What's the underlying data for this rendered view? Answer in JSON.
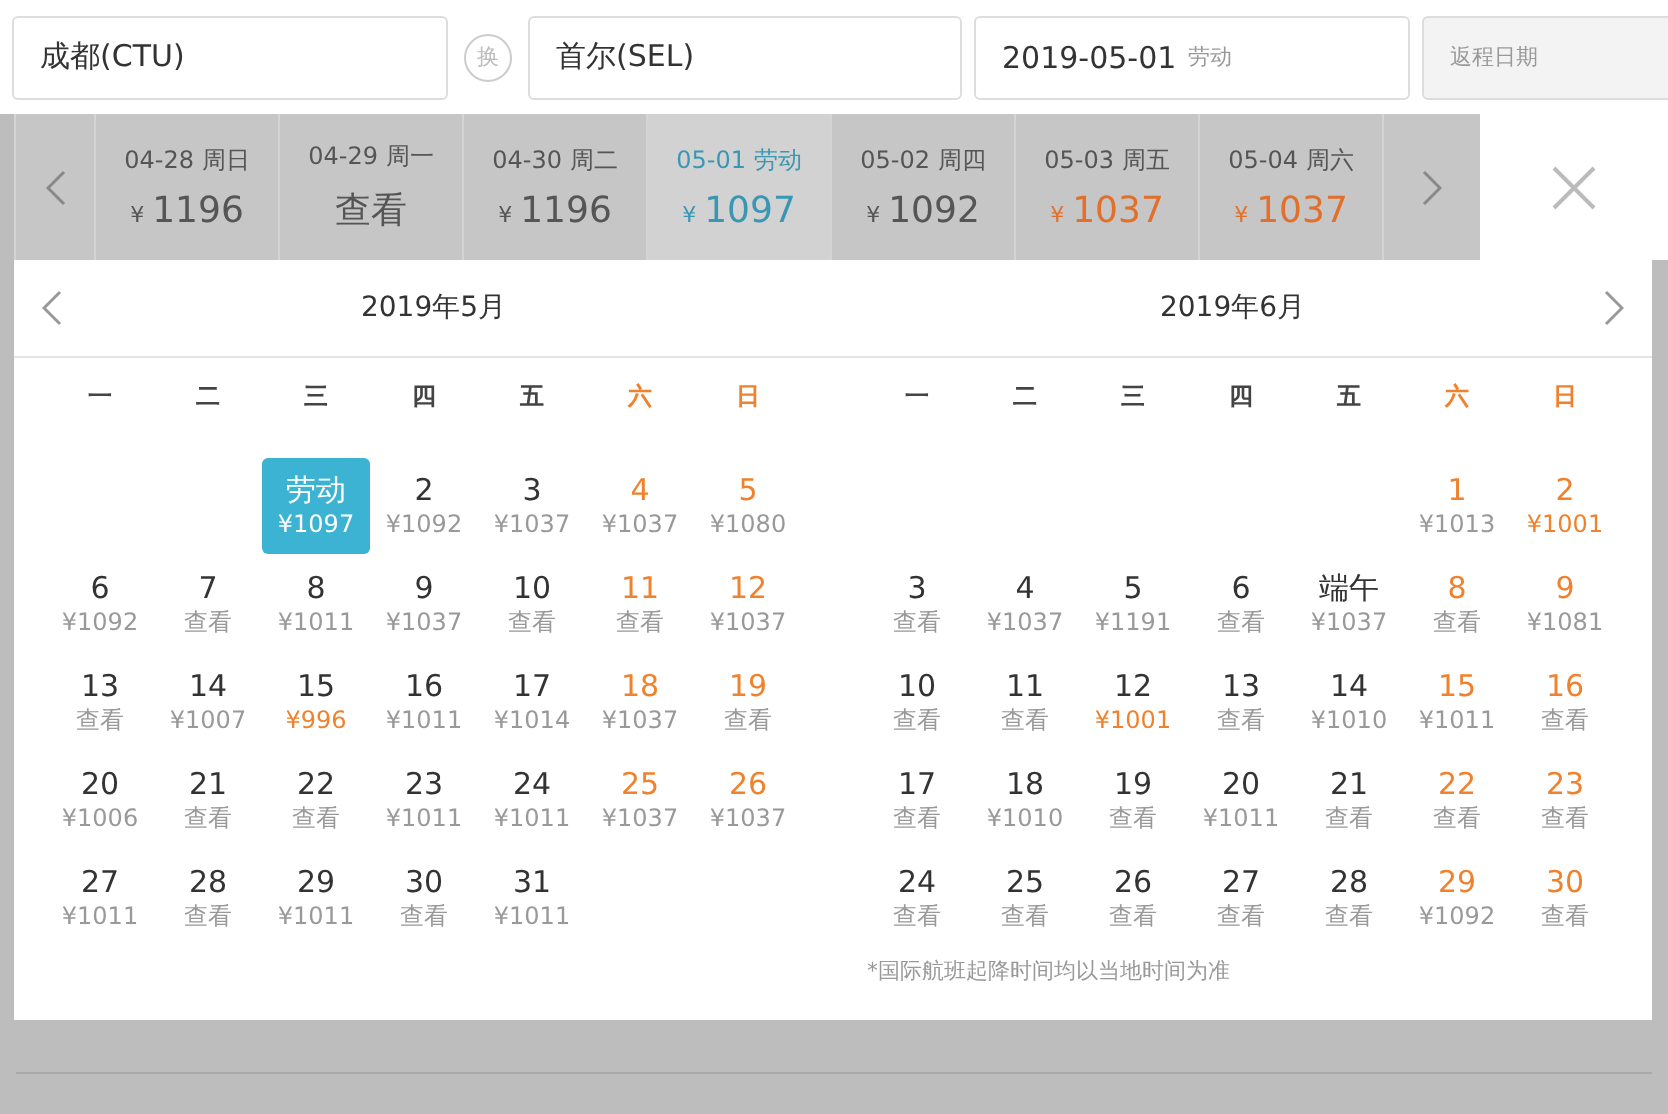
{
  "search": {
    "origin": "成都(CTU)",
    "swap": "换",
    "destination": "首尔(SEL)",
    "depart_date": "2019-05-01",
    "depart_holiday": "劳动",
    "return_placeholder": "返程日期"
  },
  "date_strip": [
    {
      "date": "04-28 周日",
      "currency": "¥",
      "price": "1196",
      "selected": false,
      "low": false
    },
    {
      "date": "04-29 周一",
      "price": "查看",
      "selected": false,
      "low": false
    },
    {
      "date": "04-30 周二",
      "currency": "¥",
      "price": "1196",
      "selected": false,
      "low": false
    },
    {
      "date": "05-01 劳动",
      "currency": "¥",
      "price": "1097",
      "selected": true
    },
    {
      "date": "05-02 周四",
      "currency": "¥",
      "price": "1092",
      "selected": false,
      "low": false
    },
    {
      "date": "05-03 周五",
      "currency": "¥",
      "price": "1037",
      "selected": false,
      "low": true
    },
    {
      "date": "05-04 周六",
      "currency": "¥",
      "price": "1037",
      "selected": false,
      "low": true
    }
  ],
  "months": [
    {
      "title": "2019年5月",
      "weekdays": [
        "一",
        "二",
        "三",
        "四",
        "五",
        "六",
        "日"
      ],
      "weeks": [
        [
          {
            "kind": "blank"
          },
          {
            "kind": "blank"
          },
          {
            "kind": "day",
            "day": "劳动",
            "price": "¥1097",
            "selected": true
          },
          {
            "kind": "day",
            "day": "2",
            "price": "¥1092",
            "selected": false,
            "low": false
          },
          {
            "kind": "day",
            "day": "3",
            "price": "¥1037",
            "selected": false,
            "low": false
          },
          {
            "kind": "day",
            "day": "4",
            "price": "¥1037",
            "selected": false,
            "low": false
          },
          {
            "kind": "day",
            "day": "5",
            "price": "¥1080",
            "selected": false,
            "low": false
          }
        ],
        [
          {
            "kind": "day",
            "day": "6",
            "price": "¥1092",
            "selected": false,
            "low": false
          },
          {
            "kind": "day",
            "day": "7",
            "price": "查看",
            "selected": false,
            "low": false
          },
          {
            "kind": "day",
            "day": "8",
            "price": "¥1011",
            "selected": false,
            "low": false
          },
          {
            "kind": "day",
            "day": "9",
            "price": "¥1037",
            "selected": false,
            "low": false
          },
          {
            "kind": "day",
            "day": "10",
            "price": "查看",
            "selected": false,
            "low": false
          },
          {
            "kind": "day",
            "day": "11",
            "price": "查看",
            "selected": false,
            "low": false
          },
          {
            "kind": "day",
            "day": "12",
            "price": "¥1037",
            "selected": false,
            "low": false
          }
        ],
        [
          {
            "kind": "day",
            "day": "13",
            "price": "查看",
            "selected": false,
            "low": false
          },
          {
            "kind": "day",
            "day": "14",
            "price": "¥1007",
            "selected": false,
            "low": false
          },
          {
            "kind": "day",
            "day": "15",
            "price": "¥996",
            "selected": false,
            "low": true
          },
          {
            "kind": "day",
            "day": "16",
            "price": "¥1011",
            "selected": false,
            "low": false
          },
          {
            "kind": "day",
            "day": "17",
            "price": "¥1014",
            "selected": false,
            "low": false
          },
          {
            "kind": "day",
            "day": "18",
            "price": "¥1037",
            "selected": false,
            "low": false
          },
          {
            "kind": "day",
            "day": "19",
            "price": "查看",
            "selected": false,
            "low": false
          }
        ],
        [
          {
            "kind": "day",
            "day": "20",
            "price": "¥1006",
            "selected": false,
            "low": false
          },
          {
            "kind": "day",
            "day": "21",
            "price": "查看",
            "selected": false,
            "low": false
          },
          {
            "kind": "day",
            "day": "22",
            "price": "查看",
            "selected": false,
            "low": false
          },
          {
            "kind": "day",
            "day": "23",
            "price": "¥1011",
            "selected": false,
            "low": false
          },
          {
            "kind": "day",
            "day": "24",
            "price": "¥1011",
            "selected": false,
            "low": false
          },
          {
            "kind": "day",
            "day": "25",
            "price": "¥1037",
            "selected": false,
            "low": false
          },
          {
            "kind": "day",
            "day": "26",
            "price": "¥1037",
            "selected": false,
            "low": false
          }
        ],
        [
          {
            "kind": "day",
            "day": "27",
            "price": "¥1011",
            "selected": false,
            "low": false
          },
          {
            "kind": "day",
            "day": "28",
            "price": "查看",
            "selected": false,
            "low": false
          },
          {
            "kind": "day",
            "day": "29",
            "price": "¥1011",
            "selected": false,
            "low": false
          },
          {
            "kind": "day",
            "day": "30",
            "price": "查看",
            "selected": false,
            "low": false
          },
          {
            "kind": "day",
            "day": "31",
            "price": "¥1011",
            "selected": false,
            "low": false
          }
        ]
      ]
    },
    {
      "title": "2019年6月",
      "weekdays": [
        "一",
        "二",
        "三",
        "四",
        "五",
        "六",
        "日"
      ],
      "weeks": [
        [
          {
            "kind": "blank"
          },
          {
            "kind": "blank"
          },
          {
            "kind": "blank"
          },
          {
            "kind": "blank"
          },
          {
            "kind": "blank"
          },
          {
            "kind": "day",
            "day": "1",
            "price": "¥1013",
            "selected": false,
            "low": false
          },
          {
            "kind": "day",
            "day": "2",
            "price": "¥1001",
            "selected": false,
            "low": true
          }
        ],
        [
          {
            "kind": "day",
            "day": "3",
            "price": "查看",
            "selected": false,
            "low": false
          },
          {
            "kind": "day",
            "day": "4",
            "price": "¥1037",
            "selected": false,
            "low": false
          },
          {
            "kind": "day",
            "day": "5",
            "price": "¥1191",
            "selected": false,
            "low": false
          },
          {
            "kind": "day",
            "day": "6",
            "price": "查看",
            "selected": false,
            "low": false
          },
          {
            "kind": "day",
            "day": "端午",
            "price": "¥1037",
            "selected": false,
            "low": false
          },
          {
            "kind": "day",
            "day": "8",
            "price": "查看",
            "selected": false,
            "low": false
          },
          {
            "kind": "day",
            "day": "9",
            "price": "¥1081",
            "selected": false,
            "low": false
          }
        ],
        [
          {
            "kind": "day",
            "day": "10",
            "price": "查看",
            "selected": false,
            "low": false
          },
          {
            "kind": "day",
            "day": "11",
            "price": "查看",
            "selected": false,
            "low": false
          },
          {
            "kind": "day",
            "day": "12",
            "price": "¥1001",
            "selected": false,
            "low": true
          },
          {
            "kind": "day",
            "day": "13",
            "price": "查看",
            "selected": false,
            "low": false
          },
          {
            "kind": "day",
            "day": "14",
            "price": "¥1010",
            "selected": false,
            "low": false
          },
          {
            "kind": "day",
            "day": "15",
            "price": "¥1011",
            "selected": false,
            "low": false
          },
          {
            "kind": "day",
            "day": "16",
            "price": "查看",
            "selected": false,
            "low": false
          }
        ],
        [
          {
            "kind": "day",
            "day": "17",
            "price": "查看",
            "selected": false,
            "low": false
          },
          {
            "kind": "day",
            "day": "18",
            "price": "¥1010",
            "selected": false,
            "low": false
          },
          {
            "kind": "day",
            "day": "19",
            "price": "查看",
            "selected": false,
            "low": false
          },
          {
            "kind": "day",
            "day": "20",
            "price": "¥1011",
            "selected": false,
            "low": false
          },
          {
            "kind": "day",
            "day": "21",
            "price": "查看",
            "selected": false,
            "low": false
          },
          {
            "kind": "day",
            "day": "22",
            "price": "查看",
            "selected": false,
            "low": false
          },
          {
            "kind": "day",
            "day": "23",
            "price": "查看",
            "selected": false,
            "low": false
          }
        ],
        [
          {
            "kind": "day",
            "day": "24",
            "price": "查看",
            "selected": false,
            "low": false
          },
          {
            "kind": "day",
            "day": "25",
            "price": "查看",
            "selected": false,
            "low": false
          },
          {
            "kind": "day",
            "day": "26",
            "price": "查看",
            "selected": false,
            "low": false
          },
          {
            "kind": "day",
            "day": "27",
            "price": "查看",
            "selected": false,
            "low": false
          },
          {
            "kind": "day",
            "day": "28",
            "price": "查看",
            "selected": false,
            "low": false
          },
          {
            "kind": "day",
            "day": "29",
            "price": "¥1092",
            "selected": false,
            "low": false
          },
          {
            "kind": "day",
            "day": "30",
            "price": "查看",
            "selected": false,
            "low": false
          }
        ]
      ]
    }
  ],
  "footnote": "*国际航班起降时间均以当地时间为准"
}
